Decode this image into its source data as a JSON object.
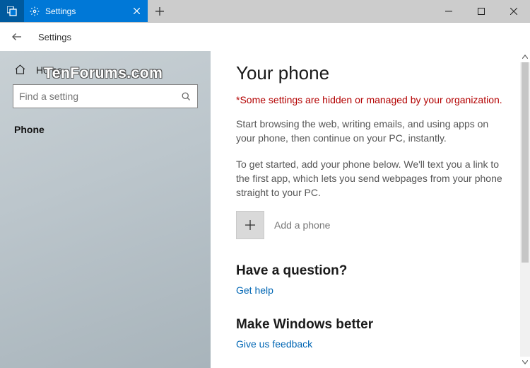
{
  "titlebar": {
    "tab_title": "Settings",
    "minimize_glyph": "—",
    "maximize_glyph": "▢",
    "close_glyph": "✕"
  },
  "subheader": {
    "title": "Settings"
  },
  "sidebar": {
    "home_label": "Home",
    "search_placeholder": "Find a setting",
    "nav_items": [
      {
        "label": "Phone"
      }
    ]
  },
  "watermark": "TenForums.com",
  "content": {
    "heading": "Your phone",
    "org_warning": "*Some settings are hidden or managed by your organization.",
    "desc1": "Start browsing the web, writing emails, and using apps on your phone, then continue on your PC, instantly.",
    "desc2": "To get started, add your phone below. We'll text you a link to the first app, which lets you send webpages from your phone straight to your PC.",
    "add_phone_label": "Add a phone",
    "question_heading": "Have a question?",
    "get_help_link": "Get help",
    "feedback_heading": "Make Windows better",
    "feedback_link": "Give us feedback"
  },
  "icons": {
    "multitask": "multitask-icon",
    "gear": "gear-icon",
    "close_tab": "close-icon",
    "new_tab": "plus-icon",
    "back": "back-arrow-icon",
    "home": "home-icon",
    "search": "search-icon",
    "add": "plus-icon"
  }
}
